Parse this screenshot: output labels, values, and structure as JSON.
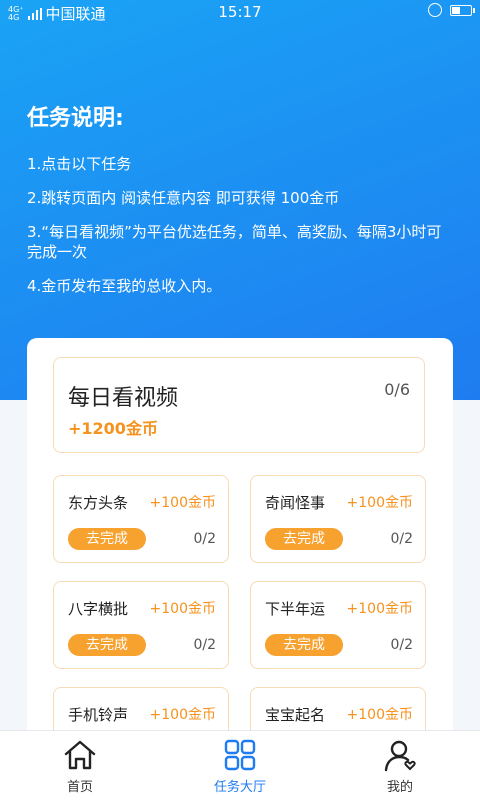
{
  "status_bar": {
    "net_top": "4G⁺",
    "net_bottom": "4G",
    "carrier": "中国联通",
    "time": "15:17"
  },
  "intro": {
    "title": "任务说明:",
    "lines": [
      "1.点击以下任务",
      "2.跳转页面内 阅读任意内容 即可获得 100金币",
      "3.“每日看视频”为平台优选任务，简单、高奖励、每隔3小时可 完成一次",
      "4.金币发布至我的总收入内。"
    ]
  },
  "main_task": {
    "title": "每日看视频",
    "count": "0/6",
    "reward": "+1200金币"
  },
  "tasks": [
    {
      "name": "东方头条",
      "reward": "+100金币",
      "button": "去完成",
      "progress": "0/2"
    },
    {
      "name": "奇闻怪事",
      "reward": "+100金币",
      "button": "去完成",
      "progress": "0/2"
    },
    {
      "name": "八字横批",
      "reward": "+100金币",
      "button": "去完成",
      "progress": "0/2"
    },
    {
      "name": "下半年运",
      "reward": "+100金币",
      "button": "去完成",
      "progress": "0/2"
    },
    {
      "name": "手机铃声",
      "reward": "+100金币"
    },
    {
      "name": "宝宝起名",
      "reward": "+100金币"
    }
  ],
  "tabbar": {
    "items": [
      {
        "label": "首页",
        "icon": "home-icon"
      },
      {
        "label": "任务大厅",
        "icon": "grid-icon",
        "active": true
      },
      {
        "label": "我的",
        "icon": "user-icon"
      }
    ]
  },
  "colors": {
    "primary_blue": "#1f7cf0",
    "accent_orange": "#f6921e",
    "button_orange": "#f7a12e"
  }
}
